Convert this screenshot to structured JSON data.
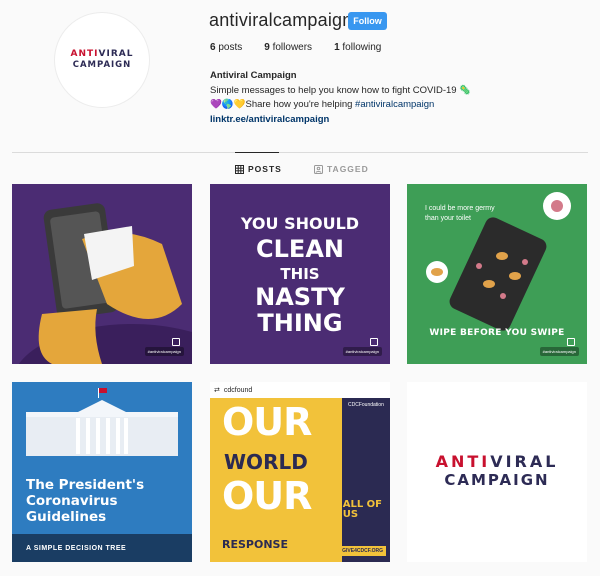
{
  "profile": {
    "username": "antiviralcampaign",
    "follow_label": "Follow",
    "avatar_logo": {
      "part1_red": "ANTI",
      "part1_navy": "VIRAL",
      "part2": "CAMPAIGN"
    },
    "stats": {
      "posts_count": "6",
      "posts_label": "posts",
      "followers_count": "9",
      "followers_label": "followers",
      "following_count": "1",
      "following_label": "following"
    },
    "bio": {
      "name": "Antiviral Campaign",
      "line1": "Simple messages to help you know how to fight COVID-19 🦠",
      "line2_prefix": "💜🌎💛Share how you're helping ",
      "hashtag": "#antiviralcampaign",
      "link": "linktr.ee/antiviralcampaign"
    }
  },
  "tabs": {
    "posts": "POSTS",
    "tagged": "TAGGED"
  },
  "posts": {
    "handle": "#antiviralcampaign",
    "clean": {
      "l1": "YOU SHOULD",
      "l2": "CLEAN",
      "l3": "THIS",
      "l4": "NASTY",
      "l5": "THING"
    },
    "germy": {
      "l1": "I could be more germy",
      "l2": "than your toilet",
      "cta": "WIPE BEFORE YOU SWIPE"
    },
    "president": {
      "l1": "The President's",
      "l2": "Coronavirus",
      "l3": "Guidelines",
      "bar": "A SIMPLE DECISION TREE"
    },
    "cdc": {
      "repost_user": "cdcfound",
      "our1": "OUR",
      "world": "WORLD",
      "our2": "OUR",
      "response": "RESPONSE",
      "org": "CDCFoundation",
      "allof": "ALL OF",
      "us": "US",
      "give": "GIVE4CDCF.ORG"
    },
    "logo": {
      "part1_red": "ANTI",
      "part1_navy": "VIRAL",
      "part2": "CAMPAIGN"
    }
  },
  "colors": {
    "accent": "#3897f0",
    "brand_red": "#c8102e",
    "brand_navy": "#2d2b55",
    "purple_tile": "#4b2c73",
    "green_tile": "#3e9e56",
    "blue_tile": "#2e7cc0",
    "yellow_tile": "#f2c23a"
  }
}
